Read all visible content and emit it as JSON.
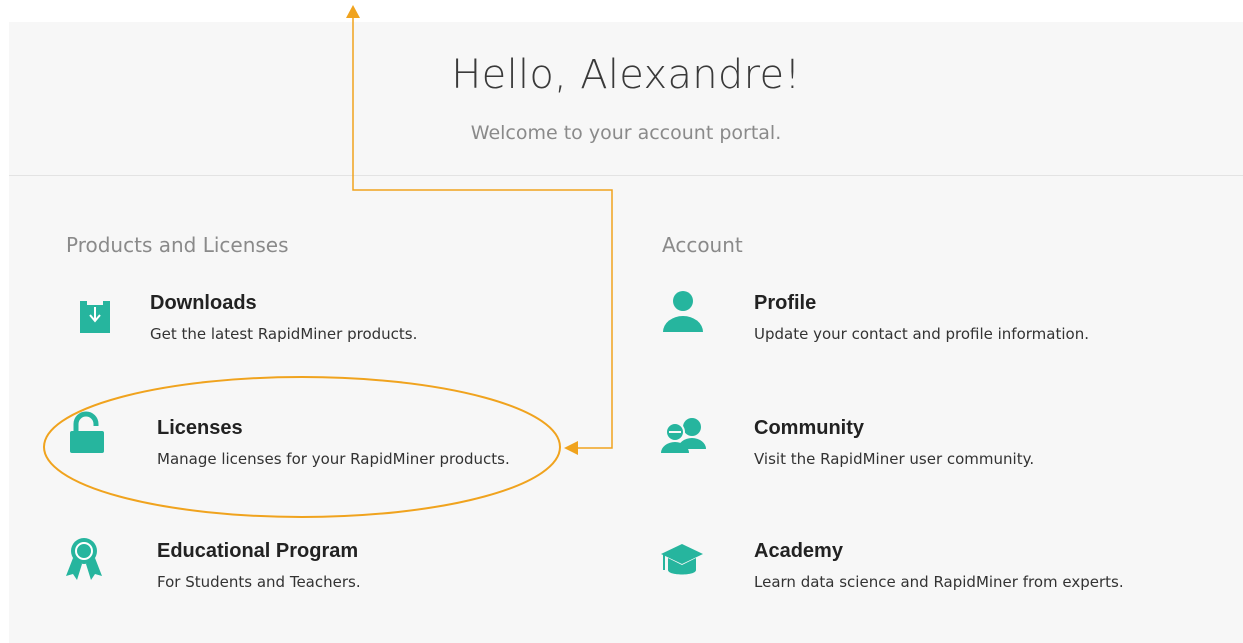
{
  "header": {
    "greeting": "Hello, Alexandre!",
    "subtitle": "Welcome to your account portal."
  },
  "products": {
    "heading": "Products and Licenses",
    "items": [
      {
        "icon": "download-icon",
        "title": "Downloads",
        "desc": "Get the latest RapidMiner products."
      },
      {
        "icon": "unlocked-padlock-icon",
        "title": "Licenses",
        "desc": "Manage licenses for your RapidMiner products."
      },
      {
        "icon": "award-ribbon-icon",
        "title": "Educational Program",
        "desc": "For Students and Teachers."
      }
    ]
  },
  "account": {
    "heading": "Account",
    "items": [
      {
        "icon": "user-icon",
        "title": "Profile",
        "desc": "Update your contact and profile information."
      },
      {
        "icon": "community-icon",
        "title": "Community",
        "desc": "Visit the RapidMiner user community."
      },
      {
        "icon": "graduation-cap-icon",
        "title": "Academy",
        "desc": "Learn data science and RapidMiner from experts."
      }
    ]
  },
  "colors": {
    "accent": "#26b59e",
    "annotation": "#f0a31e",
    "panel_bg": "#f7f7f7"
  }
}
